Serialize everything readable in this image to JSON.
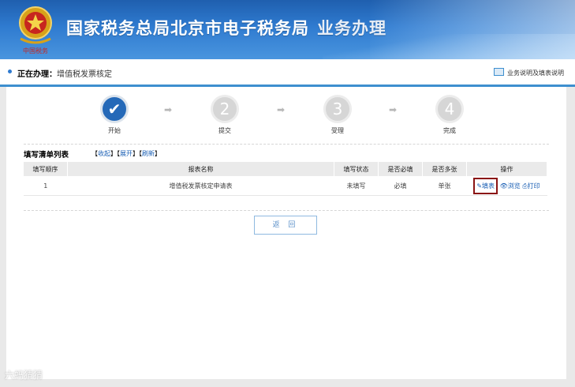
{
  "header": {
    "title": "国家税务总局北京市电子税务局",
    "subtitle": "业务办理",
    "emblem_text": "中国税务",
    "bg_color": "#2f7bd0"
  },
  "bar": {
    "current_label": "正在办理：",
    "current_value": "增值税发票核定",
    "help_link": "业务说明及填表说明"
  },
  "steps": [
    {
      "label": "开始",
      "symbol": "✔",
      "state": "done"
    },
    {
      "label": "提交",
      "symbol": "2",
      "state": "todo"
    },
    {
      "label": "受理",
      "symbol": "3",
      "state": "todo"
    },
    {
      "label": "完成",
      "symbol": "4",
      "state": "todo"
    }
  ],
  "list": {
    "title": "填写清单列表",
    "collapse": "收起",
    "expand": "展开",
    "refresh": "刷新",
    "columns": [
      "填写顺序",
      "报表名称",
      "填写状态",
      "是否必填",
      "是否多张",
      "操作"
    ],
    "rows": [
      {
        "order": "1",
        "name": "增值税发票核定申请表",
        "status": "未填写",
        "required": "必填",
        "multiple": "单张",
        "actions": {
          "fill": "填表",
          "view": "浏览",
          "print": "打印"
        }
      }
    ]
  },
  "return_button": "返 回",
  "watermark": "六蚂猜猜"
}
